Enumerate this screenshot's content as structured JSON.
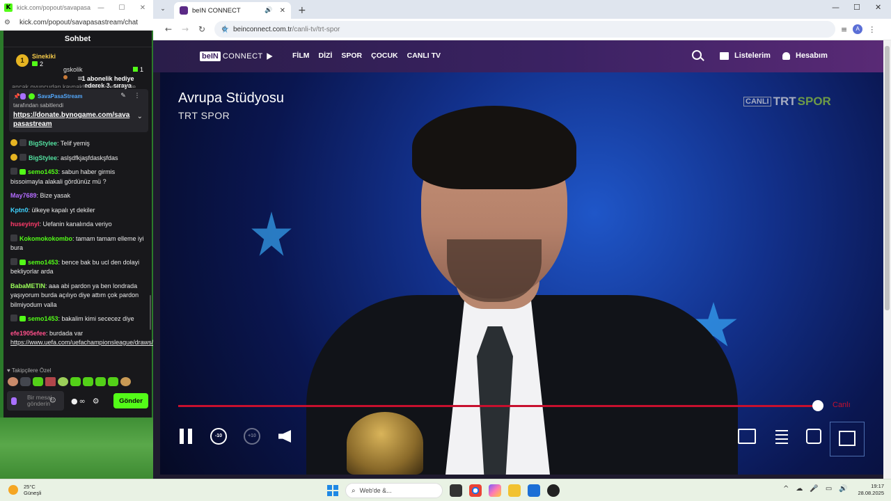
{
  "popout": {
    "title": "kick.com/popout/savapasas...",
    "url": "kick.com/popout/savapasastream/chat",
    "chat_title": "Sohbet",
    "gifters": [
      {
        "rank": "1",
        "name": "Sinekiki",
        "count": "2"
      },
      {
        "name": "gskolik",
        "count": "1"
      }
    ],
    "gift_notice": "1 abonelik hediye ederek 3. sıraya yükselin",
    "partial_line": "ancak oyuncudan kaynaklanan bir problemle",
    "pinned": {
      "streamer": "SavaPasaStream",
      "by": "tarafından sabitlendi",
      "link": "https://donate.bynogame.com/savapasastream"
    },
    "messages": [
      {
        "user": "BigStylee",
        "color": "#53e0a0",
        "text": ": Telif yemiş"
      },
      {
        "user": "BigStylee",
        "color": "#53e0a0",
        "text": ": aslşdfkjaşfdaskşfdas"
      },
      {
        "user": "semo1453",
        "color": "#53fc18",
        "text": ": sabun haber girmis bissoimayla alakali gördünüz mü ?"
      },
      {
        "user": "May7689",
        "color": "#b46bff",
        "text": ": Bize yasak"
      },
      {
        "user": "Kptn0",
        "color": "#3fd3ff",
        "text": ": ülkeye kapalı yt dekiler"
      },
      {
        "user": "huseyinyl",
        "color": "#ff3b6b",
        "text": ": Uefanin kanalında veriyo"
      },
      {
        "user": "Kokomokokombo",
        "color": "#53fc18",
        "text": ": tamam tamam elleme iyi bura"
      },
      {
        "user": "semo1453",
        "color": "#53fc18",
        "text": ": bence bak bu ucl den dolayi bekliyorlar arda"
      },
      {
        "user": "BabaMETIN",
        "color": "#9cff5a",
        "text": ": aaa abi pardon ya ben londrada yaşıyorum burda açılıyo diye attım çok pardon bilmiyodum valla"
      },
      {
        "user": "semo1453",
        "color": "#53fc18",
        "text": ": bakalim kimi sececez diye"
      },
      {
        "user": "efe1905efee",
        "color": "#ff4f8b",
        "text": ": burdada var",
        "link": "https://www.uefa.com/uefachampionsleague/draws/"
      }
    ],
    "followers_label": "Takipçilere Özel",
    "input_placeholder": "Bir mesaj gönderin",
    "send_label": "Gönder"
  },
  "browser": {
    "tab_title": "beIN CONNECT",
    "url_host": "beinconnect.com.tr",
    "url_path": "/canli-tv/trt-spor",
    "avatar": "A"
  },
  "bein": {
    "logo_main": "beIN",
    "logo_sub": "CONNECT",
    "nav": [
      "FİLM",
      "DİZİ",
      "SPOR",
      "ÇOCUK",
      "CANLI TV"
    ],
    "listelerim": "Listelerim",
    "hesabim": "Hesabım",
    "program_title": "Avrupa Stüdyosu",
    "channel_name": "TRT SPOR",
    "chan_logo": {
      "live": "CANLI",
      "trt": "TRT",
      "spor": "SPOR"
    },
    "live_label": "Canlı",
    "skip_back": "-10",
    "skip_fwd": "+10",
    "progress": 0.99
  },
  "taskbar": {
    "temp": "25°C",
    "weather": "Güneşli",
    "search": "Web'de &...",
    "time": "19:17",
    "date": "28.08.2025"
  },
  "colors": {
    "kick_green": "#53fc18",
    "bein_purple": "#3b2263",
    "live_red": "#c8102e"
  }
}
